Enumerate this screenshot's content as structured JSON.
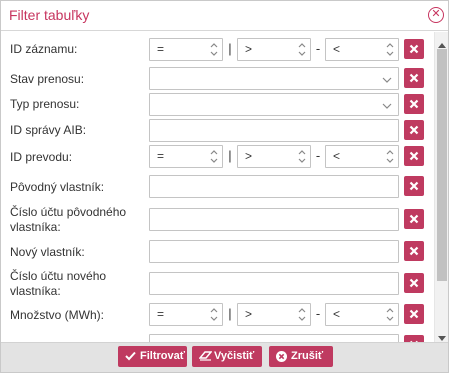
{
  "dialog": {
    "title": "Filter tabuľky",
    "close_icon": "close-circle-icon"
  },
  "accent_color": "#bf3a60",
  "fields": {
    "id_zaznamu": {
      "label": "ID záznamu:",
      "op1": "=",
      "op2": ">",
      "op3": "<",
      "sep1": "|",
      "sep2": "-"
    },
    "stav_prenosu": {
      "label": "Stav prenosu:",
      "value": ""
    },
    "typ_prenosu": {
      "label": "Typ prenosu:",
      "value": ""
    },
    "id_spravy_aib": {
      "label": "ID správy AIB:",
      "value": ""
    },
    "id_prevodu": {
      "label": "ID prevodu:",
      "op1": "=",
      "op2": ">",
      "op3": "<",
      "sep1": "|",
      "sep2": "-"
    },
    "povodny_vlastnik": {
      "label": "Pôvodný vlastník:",
      "value": ""
    },
    "cislo_uctu_povodneho": {
      "label": "Číslo účtu pôvodného vlastníka:",
      "value": ""
    },
    "novy_vlastnik": {
      "label": "Nový vlastník:",
      "value": ""
    },
    "cislo_uctu_noveho": {
      "label": "Číslo účtu nového vlastníka:",
      "value": ""
    },
    "mnozstvo": {
      "label": "Množstvo (MWh):",
      "op1": "=",
      "op2": ">",
      "op3": "<",
      "sep1": "|",
      "sep2": "-"
    }
  },
  "footer": {
    "filter_label": "Filtrovať",
    "clear_label": "Vyčistiť",
    "cancel_label": "Zrušiť"
  }
}
